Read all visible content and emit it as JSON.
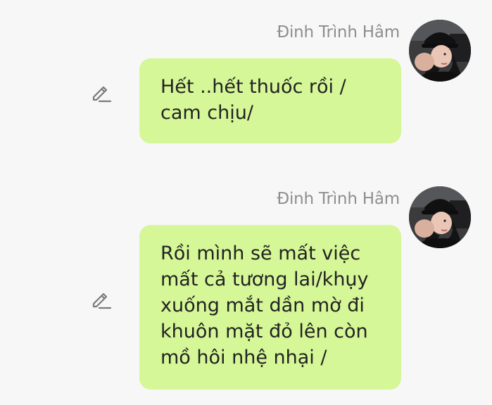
{
  "messages": [
    {
      "sender": "Đinh Trình Hâm",
      "text": "Hết ..hết thuốc rồi /\ncam chịu/",
      "avatar_icon": "user-avatar",
      "edit_icon": "edit-pencil-icon"
    },
    {
      "sender": "Đinh Trình Hâm",
      "text": "Rồi mình sẽ mất việc\nmất cả tương lai/khụy\nxuống mắt dần mờ đi\nkhuôn mặt đỏ lên còn\nmồ hôi nhệ nhại /",
      "avatar_icon": "user-avatar",
      "edit_icon": "edit-pencil-icon"
    }
  ],
  "colors": {
    "background": "#f7f7f7",
    "bubble": "#d5f797",
    "sender_name": "#8e8e8e",
    "message_text": "#222222"
  }
}
